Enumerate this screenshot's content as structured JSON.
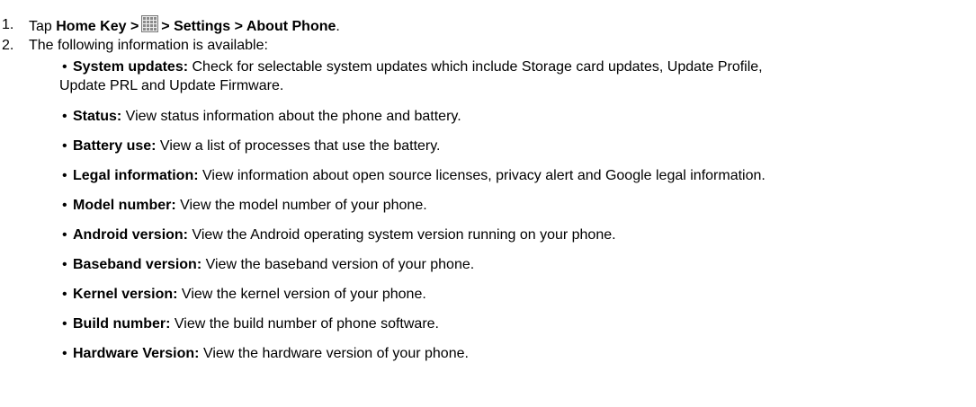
{
  "steps": [
    {
      "number": "1.",
      "prefix": "Tap ",
      "bold_home": "Home Key >",
      "icon": "apps-grid-icon",
      "bold_path": "> Settings > About Phone",
      "suffix": "."
    },
    {
      "number": "2.",
      "text": "The following information is available:"
    }
  ],
  "bullets": [
    {
      "term": "System updates:",
      "desc": " Check for selectable system updates which include Storage card updates, Update Profile,",
      "cont": "Update PRL and Update Firmware."
    },
    {
      "term": "Status:",
      "desc": " View status information about the phone and battery."
    },
    {
      "term": "Battery use:",
      "desc": " View a list of processes that use the battery."
    },
    {
      "term": "Legal information:",
      "desc": " View information about open source licenses, privacy alert and Google legal information."
    },
    {
      "term": "Model number:",
      "desc": " View the model number of your phone."
    },
    {
      "term": "Android version:",
      "desc": " View the Android operating system version running on your phone."
    },
    {
      "term": "Baseband version:",
      "desc": " View the baseband version of your phone."
    },
    {
      "term": "Kernel version:",
      "desc": " View the kernel version of your phone."
    },
    {
      "term": "Build number:",
      "desc": " View the build number of phone software."
    },
    {
      "term": "Hardware Version:",
      "desc": " View the hardware version of your phone."
    }
  ],
  "bullet_symbol": "•",
  "colors": {
    "text": "#000000",
    "icon_border": "#7a7a7a",
    "icon_cell": "#9a9a9a"
  }
}
